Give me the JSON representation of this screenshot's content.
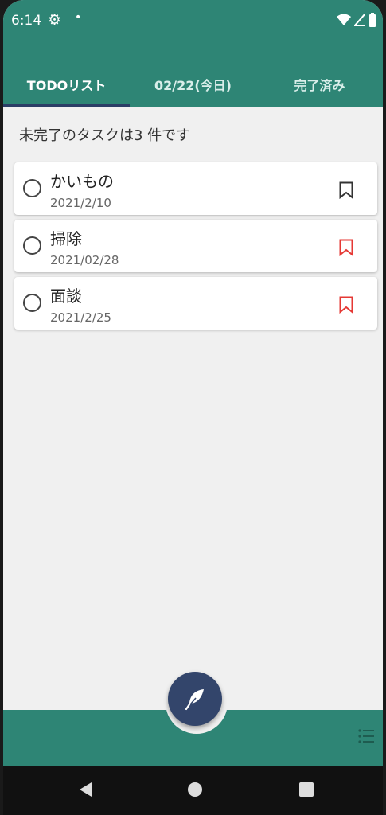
{
  "status": {
    "time": "6:14"
  },
  "tabs": [
    {
      "label": "TODOリスト",
      "active": true
    },
    {
      "label": "02/22(今日)",
      "active": false
    },
    {
      "label": "完了済み",
      "active": false
    }
  ],
  "summary_text": "未完了のタスクは3 件です",
  "tasks": [
    {
      "title": "かいもの",
      "date": "2021/2/10",
      "bookmark_color": "#333333"
    },
    {
      "title": "掃除",
      "date": "2021/02/28",
      "bookmark_color": "#e53935"
    },
    {
      "title": "面談",
      "date": "2021/2/25",
      "bookmark_color": "#e53935"
    }
  ],
  "colors": {
    "primary": "#2e8575",
    "accent": "#33456b",
    "background": "#f0f0f0"
  },
  "icons": {
    "fab": "feather-icon",
    "bottom_right": "list-menu-icon"
  }
}
